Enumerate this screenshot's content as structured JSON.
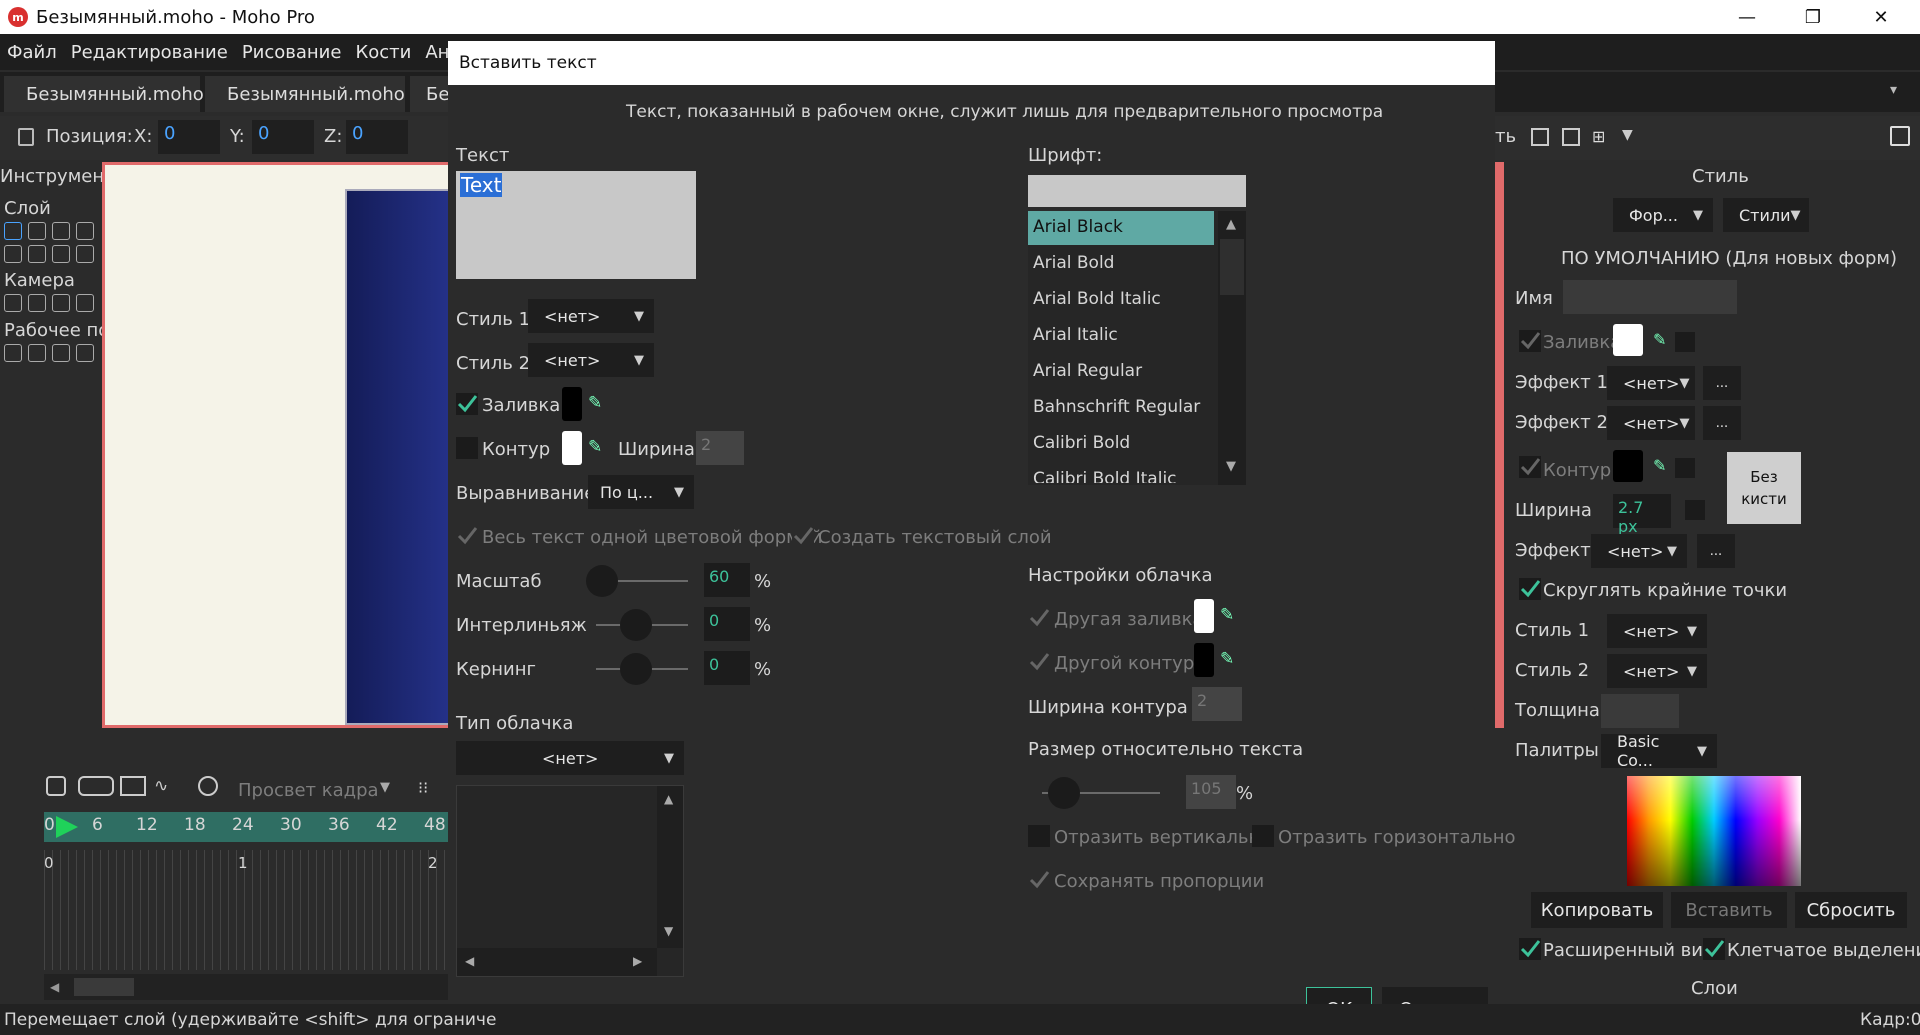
{
  "window": {
    "title": "Безымянный.moho - Moho Pro",
    "logo": "m"
  },
  "menu": [
    "Файл",
    "Редактирование",
    "Рисование",
    "Кости",
    "Анимац"
  ],
  "tabs": [
    "Безымянный.moho",
    "Безымянный.moho",
    "Бе"
  ],
  "toolbar": {
    "position_label": "Позиция:",
    "x_label": "X:",
    "x": "0",
    "y_label": "Y:",
    "y": "0",
    "z_label": "Z:",
    "z": "0",
    "right_text": "ть"
  },
  "left_panel": {
    "tools_header": "Инструменть",
    "layer_header": "Слой",
    "camera_header": "Камера",
    "workspace_header": "Рабочее по."
  },
  "timeline": {
    "preview_label": "Просвет кадра",
    "ruler": [
      "0",
      "6",
      "12",
      "18",
      "24",
      "30",
      "36",
      "42",
      "48"
    ],
    "seconds": [
      "0",
      "1",
      "2"
    ]
  },
  "status": {
    "left": "Перемещает слой (удерживайте <shift> для ограниче",
    "right": "Кадр:0"
  },
  "dialog": {
    "title": "Вставить текст",
    "note": "Текст, показанный в рабочем окне, служит лишь для предварительного просмотра",
    "text_label": "Текст",
    "text_value": "Text",
    "style1_label": "Стиль 1",
    "style1_value": "<нет>",
    "style2_label": "Стиль 2",
    "style2_value": "<нет>",
    "fill_label": "Заливка",
    "outline_label": "Контур",
    "width_label": "Ширина",
    "width_value": "2",
    "align_label": "Выравнивание",
    "align_value": "По ц...",
    "one_shape_label": "Весь текст одной цветовой формой",
    "text_layer_label": "Создать текстовый слой",
    "scale_label": "Масштаб",
    "scale_value": "60",
    "leading_label": "Интерлиньяж",
    "leading_value": "0",
    "kerning_label": "Кернинг",
    "kerning_value": "0",
    "percent": "%",
    "bubble_type_label": "Тип облачка",
    "bubble_type_value": "<нет>",
    "font_label": "Шрифт:",
    "font_search": "",
    "fonts": [
      "Arial Black",
      "Arial Bold",
      "Arial Bold Italic",
      "Arial Italic",
      "Arial Regular",
      "Bahnschrift Regular",
      "Calibri Bold",
      "Calibri Bold Italic"
    ],
    "bubble_settings_label": "Настройки облачка",
    "other_fill_label": "Другая заливка",
    "other_outline_label": "Другой контур",
    "outline_width_label": "Ширина контура",
    "outline_width_value": "2",
    "rel_size_label": "Размер относительно текста",
    "rel_size_value": "105",
    "flip_v_label": "Отразить вертикально",
    "flip_h_label": "Отразить горизонтально",
    "keep_prop_label": "Сохранять пропорции",
    "ok": "OK",
    "cancel": "Отмена"
  },
  "style_panel": {
    "header": "Стиль",
    "forms_btn": "Фор...",
    "styles_btn": "Стили",
    "default_label": "ПО УМОЛЧАНИЮ (Для новых форм)",
    "name_label": "Имя",
    "fill_label": "Заливка",
    "effect1_label": "Эффект 1",
    "effect1_value": "<нет>",
    "effect2_label": "Эффект 2",
    "effect2_value": "<нет>",
    "dots": "...",
    "outline_label": "Контур",
    "brush_btn": "Без кисти",
    "width_label": "Ширина",
    "width_value": "2.7 px",
    "effect_label": "Эффект",
    "effect_value": "<нет>",
    "round_label": "Скруглять крайние точки",
    "style1_label": "Стиль 1",
    "style1_value": "<нет>",
    "style2_label": "Стиль 2",
    "style2_value": "<нет>",
    "thickness_label": "Толщина",
    "palettes_label": "Палитры",
    "palettes_value": "Basic Co...",
    "copy_btn": "Копировать",
    "paste_btn": "Вставить",
    "reset_btn": "Сбросить",
    "extended_label": "Расширенный вид",
    "checker_label": "Клетчатое выделение",
    "layers_header": "Слои"
  },
  "colors": {
    "accent": "#4aa3ff",
    "selection": "#5fa9a4",
    "canvas_bg": "#f5f3e8",
    "stage_blue": "#1e2a7a",
    "timeline_green": "#2f6e63"
  }
}
